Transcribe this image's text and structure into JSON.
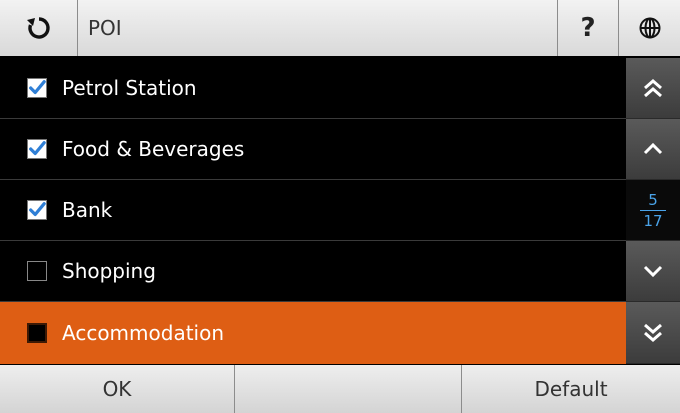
{
  "header": {
    "title": "POI",
    "help_label": "?",
    "back_icon": "refresh-icon",
    "globe_icon": "globe-icon"
  },
  "list": {
    "items": [
      {
        "label": "Petrol Station",
        "checked": true
      },
      {
        "label": "Food & Beverages",
        "checked": true
      },
      {
        "label": "Bank",
        "checked": true
      },
      {
        "label": "Shopping",
        "checked": false
      },
      {
        "label": "Accommodation",
        "checked": false,
        "selected": true
      }
    ]
  },
  "pager": {
    "current": "5",
    "total": "17"
  },
  "footer": {
    "ok_label": "OK",
    "middle_label": "",
    "default_label": "Default"
  },
  "colors": {
    "accent": "#de5e14",
    "check": "#2f7fd6",
    "page_number": "#4aa3e8"
  }
}
